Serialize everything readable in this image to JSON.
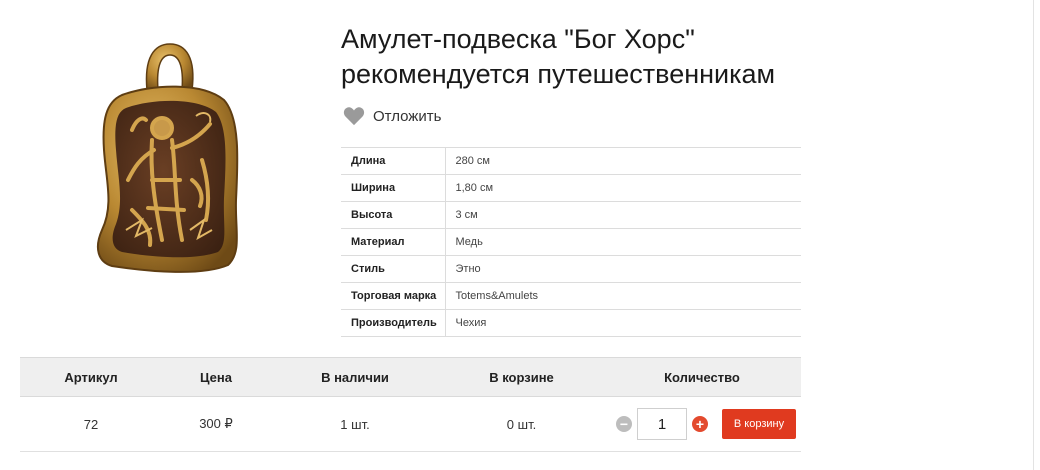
{
  "product": {
    "title_line1": "Амулет-подвеска \"Бог Хорс\"",
    "title_line2": "рекомендуется путешественникам",
    "image_name": "amulet-bog-hors-image"
  },
  "wishlist": {
    "label": "Отложить",
    "icon": "heart-icon"
  },
  "specs": [
    {
      "key": "Длина",
      "value": "280 см"
    },
    {
      "key": "Ширина",
      "value": "1,80 см"
    },
    {
      "key": "Высота",
      "value": "3 см"
    },
    {
      "key": "Материал",
      "value": "Медь"
    },
    {
      "key": "Стиль",
      "value": "Этно"
    },
    {
      "key": "Торговая марка",
      "value": "Totems&Amulets"
    },
    {
      "key": "Производитель",
      "value": "Чехия"
    }
  ],
  "buy": {
    "headers": [
      "Артикул",
      "Цена",
      "В наличии",
      "В корзине",
      "Количество"
    ],
    "article": "72",
    "price": "300 ₽",
    "in_stock": "1 шт.",
    "in_cart": "0 шт.",
    "quantity": "1",
    "minus_label": "−",
    "plus_label": "+",
    "cart_button_label": "В корзину"
  },
  "colors": {
    "accent": "#e03a1f",
    "plus": "#e34a2e",
    "minus": "#bdbdbd",
    "header_bg": "#efefef",
    "heart": "#9a9a9a"
  }
}
